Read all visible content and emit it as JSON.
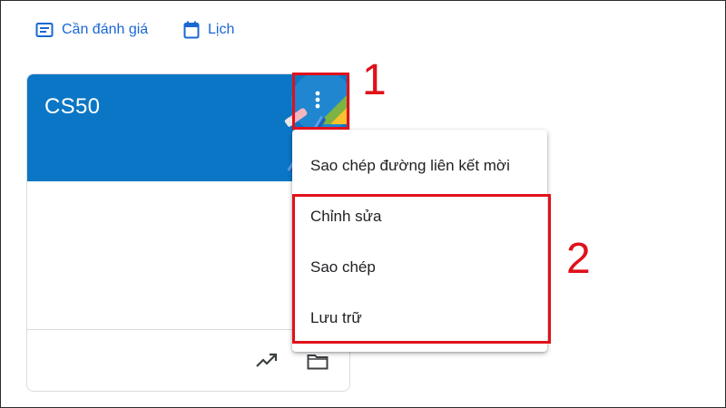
{
  "top_nav": {
    "to_review_label": "Cần đánh giá",
    "calendar_label": "Lịch"
  },
  "class_card": {
    "title": "CS50",
    "options_icon": "more-vert-icon",
    "footer_icons": [
      "trending-up-icon",
      "folder-icon"
    ]
  },
  "class_menu": {
    "items": [
      "Sao chép đường liên kết mời",
      "Chỉnh sửa",
      "Sao chép",
      "Lưu trữ"
    ]
  },
  "annotations": {
    "step_1": "1",
    "step_2": "2"
  },
  "colors": {
    "card_header": "#0b76c5",
    "link": "#1967d2",
    "annotation": "#e0111b"
  }
}
